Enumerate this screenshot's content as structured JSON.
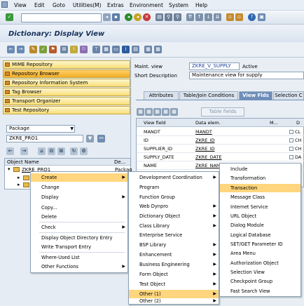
{
  "menubar": {
    "items": [
      "View",
      "Edit",
      "Goto",
      "Utilities(M)",
      "Extras",
      "Environment",
      "System",
      "Help"
    ]
  },
  "title": "Dictionary: Display View",
  "nav_buttons": [
    "MIME Repository",
    "Repository Browser",
    "Repository Information System",
    "Tag Browser",
    "Transport Organizer",
    "Test Repository"
  ],
  "package": {
    "dropdown_label": "Package",
    "value": "ZKRE_PRO1"
  },
  "tree": {
    "header_col1": "Object Name",
    "header_col2": "De...",
    "row1": "ZKRE_PRO1",
    "row1_extra": "Packag"
  },
  "view_header": {
    "maint_view_label": "Maint. view",
    "maint_view_value": "ZKRE_V_SUPPLY",
    "status": "Active",
    "short_desc_label": "Short Description",
    "short_desc_value": "Maintenance view for supply"
  },
  "tabs": [
    "Attributes",
    "Table/Join Conditions",
    "View Flds",
    "Selection C"
  ],
  "table_fields_btn": "Table fields",
  "grid": {
    "headers": [
      "View field",
      "Data elem.",
      "M...",
      "D"
    ],
    "rows": [
      [
        "MANDT",
        "MANDT",
        "",
        "CL"
      ],
      [
        "ID",
        "ZKRE_ID",
        "",
        "CH"
      ],
      [
        "SUPPLIER_ID",
        "ZKRE_ID",
        "",
        "CH"
      ],
      [
        "SUPPLY_DATE",
        "ZKRE_DATE",
        "",
        "DA"
      ],
      [
        "NAME",
        "ZKRE_NAM",
        "",
        "CH"
      ]
    ]
  },
  "context_menu": [
    "Create",
    "Change",
    "Display",
    "Copy...",
    "Delete",
    "Check",
    "Display Object Directory Entry",
    "Write Transport Entry",
    "Where-Used List",
    "Other Functions"
  ],
  "create_menu": [
    "Development Coordination",
    "Program",
    "Function Group",
    "Web Dynpro",
    "Dictionary Object",
    "Class Library",
    "Enterprise Service",
    "BSP Library",
    "Enhancement",
    "Business Engineering",
    "Form Object",
    "Test Object",
    "Other (1)",
    "Other (2)"
  ],
  "other1_menu": [
    "Include",
    "Transformation",
    "Transaction",
    "Message Class",
    "Internet Service",
    "URL Object",
    "Dialog Module",
    "Logical Database",
    "SET/GET Parameter ID",
    "Area Menu",
    "Authorization Object",
    "Selection View",
    "Checkpoint Group",
    "Fast Search View"
  ],
  "colors": {
    "highlight": "#ffd67d",
    "tab_selected": "#6f8fb9",
    "title": "#16325c"
  }
}
